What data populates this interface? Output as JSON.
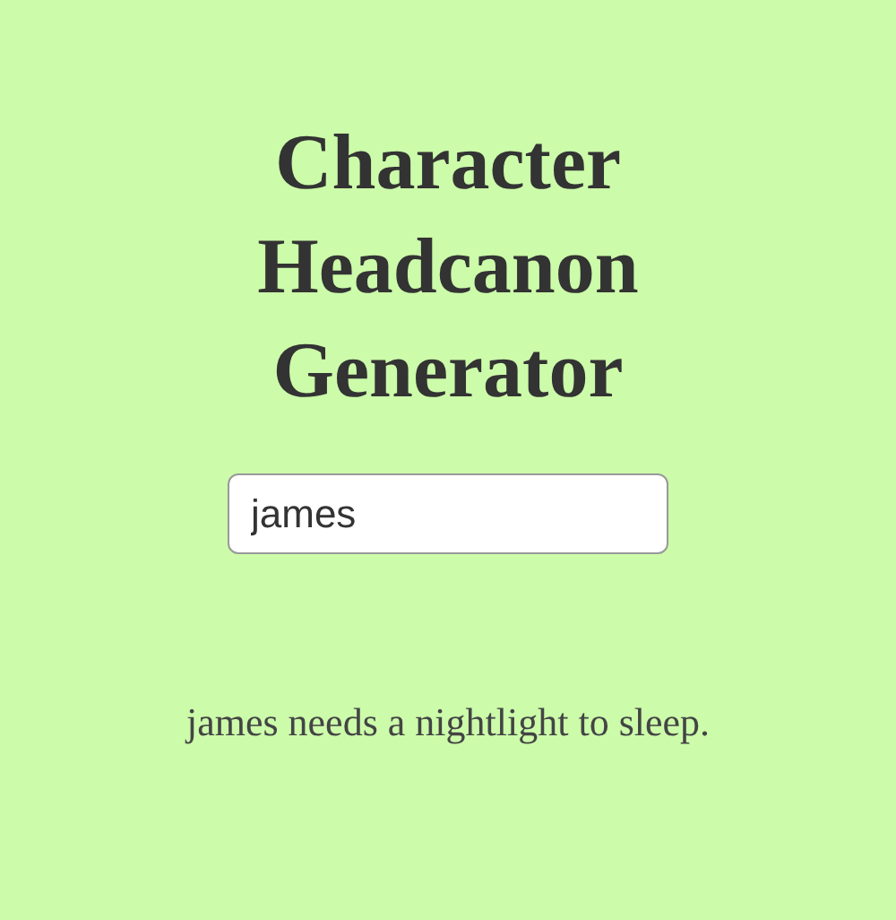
{
  "title": "Character Headcanon Generator",
  "name_field": {
    "value": "james"
  },
  "result": "james needs a nightlight to sleep."
}
